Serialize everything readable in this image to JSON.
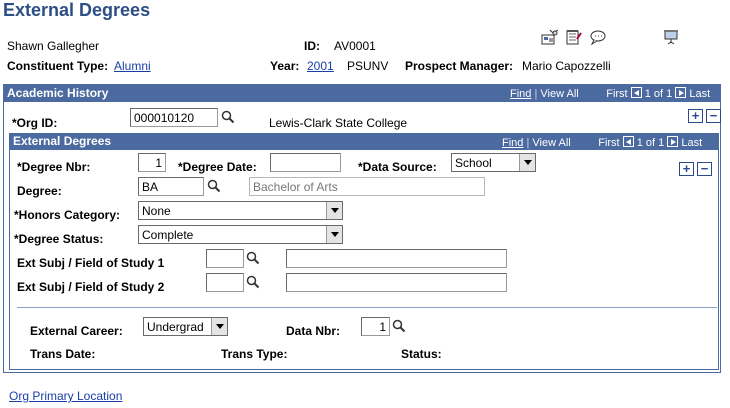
{
  "page": {
    "title": "External Degrees"
  },
  "header": {
    "name": "Shawn Gallegher",
    "id_label": "ID:",
    "id_value": "AV0001",
    "constituent_type_label": "Constituent Type:",
    "constituent_type_value": "Alumni",
    "year_label": "Year:",
    "year_value": "2001",
    "institution": "PSUNV",
    "prospect_manager_label": "Prospect Manager:",
    "prospect_manager_value": "Mario Capozzelli"
  },
  "toolbar_icons": [
    "directory-icon",
    "notepad-icon",
    "comment-icon",
    "presentation-icon"
  ],
  "academic_history": {
    "title": "Academic History",
    "nav": {
      "find": "Find",
      "view_all": "View All",
      "first": "First",
      "position": "1 of 1",
      "last": "Last"
    },
    "org_id_label": "*Org ID:",
    "org_id_value": "000010120",
    "org_name": "Lewis-Clark State College"
  },
  "external_degrees": {
    "title": "External Degrees",
    "nav": {
      "find": "Find",
      "view_all": "View All",
      "first": "First",
      "position": "1 of 1",
      "last": "Last"
    },
    "degree_nbr_label": "*Degree Nbr:",
    "degree_nbr_value": "1",
    "degree_date_label": "*Degree Date:",
    "degree_date_value": "",
    "data_source_label": "*Data Source:",
    "data_source_value": "School",
    "degree_label": "Degree:",
    "degree_value": "BA",
    "degree_desc": "Bachelor of Arts",
    "honors_label": "*Honors Category:",
    "honors_value": "None",
    "status_label": "*Degree Status:",
    "status_value": "Complete",
    "subj1_label": "Ext Subj / Field of Study 1",
    "subj1_code": "",
    "subj1_desc": "",
    "subj2_label": "Ext Subj / Field of Study 2",
    "subj2_code": "",
    "subj2_desc": "",
    "career_label": "External Career:",
    "career_value": "Undergrad",
    "data_nbr_label": "Data Nbr:",
    "data_nbr_value": "1",
    "trans_date_label": "Trans Date:",
    "trans_type_label": "Trans Type:",
    "status2_label": "Status:"
  },
  "footer": {
    "org_primary_location": "Org Primary Location"
  },
  "colors": {
    "header_blue": "#4a6aa0",
    "title_blue": "#2c4f86",
    "link": "#1a3ea8"
  }
}
